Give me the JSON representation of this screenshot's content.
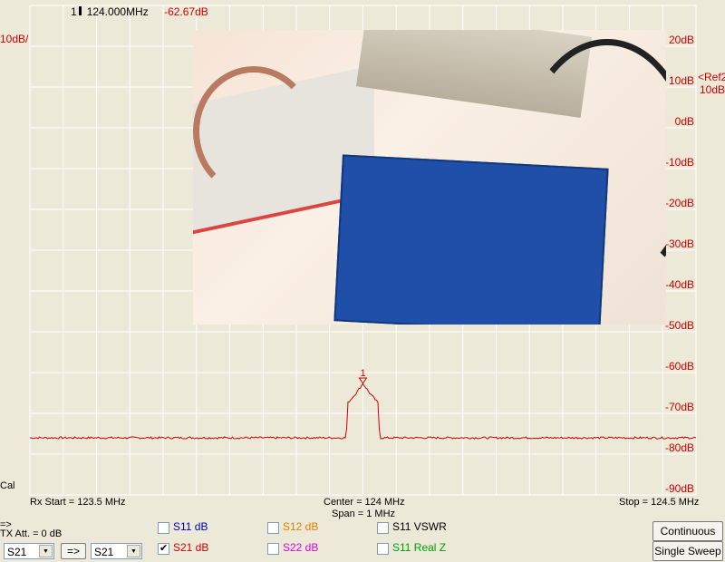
{
  "marker": {
    "label": "1",
    "frequency": "124.000MHz",
    "value": "-62.67dB"
  },
  "scale_label": "10dB/",
  "ref_label_line1": "<Ref2",
  "ref_label_line2": "10dB",
  "cal_label": "Cal",
  "freq_info": {
    "start": "Rx Start = 123.5 MHz",
    "center": "Center = 124 MHz",
    "span": "Span = 1 MHz",
    "stop": "Stop = 124.5 MHz"
  },
  "controls": {
    "arrow_label": "=>",
    "tx_att": "TX Att.  = 0 dB",
    "select_left": "S21",
    "swap_button": "=>",
    "select_right": "S21",
    "continuous_button": "Continuous",
    "single_sweep_button": "Single Sweep"
  },
  "traces": [
    {
      "label": "S11  dB",
      "checked": false,
      "color": "#0000c0"
    },
    {
      "label": "S21  dB",
      "checked": true,
      "color": "#d00000"
    },
    {
      "label": "S12  dB",
      "checked": false,
      "color": "#e08000"
    },
    {
      "label": "S22  dB",
      "checked": false,
      "color": "#e000e0"
    },
    {
      "label": "S11  VSWR",
      "checked": false,
      "color": "#000000"
    },
    {
      "label": "S11  Real Z",
      "checked": false,
      "color": "#00a000"
    }
  ],
  "chart_data": {
    "type": "line",
    "xlim": [
      123.5,
      124.5
    ],
    "ylim": [
      -90,
      30
    ],
    "y_ticks": [
      "20dB",
      "10dB",
      "0dB",
      "-10dB",
      "-20dB",
      "-30dB",
      "-40dB",
      "-50dB",
      "-60dB",
      "-70dB",
      "-80dB",
      "-90dB"
    ],
    "grid": true,
    "series": [
      {
        "color": "#d00000",
        "x": [
          123.5,
          123.975,
          123.977,
          123.99,
          124.0,
          124.01,
          124.023,
          124.025,
          124.5
        ],
        "y": [
          -76,
          -76,
          -67.5,
          -65,
          -62.67,
          -65,
          -67.5,
          -76,
          -76
        ]
      }
    ]
  }
}
